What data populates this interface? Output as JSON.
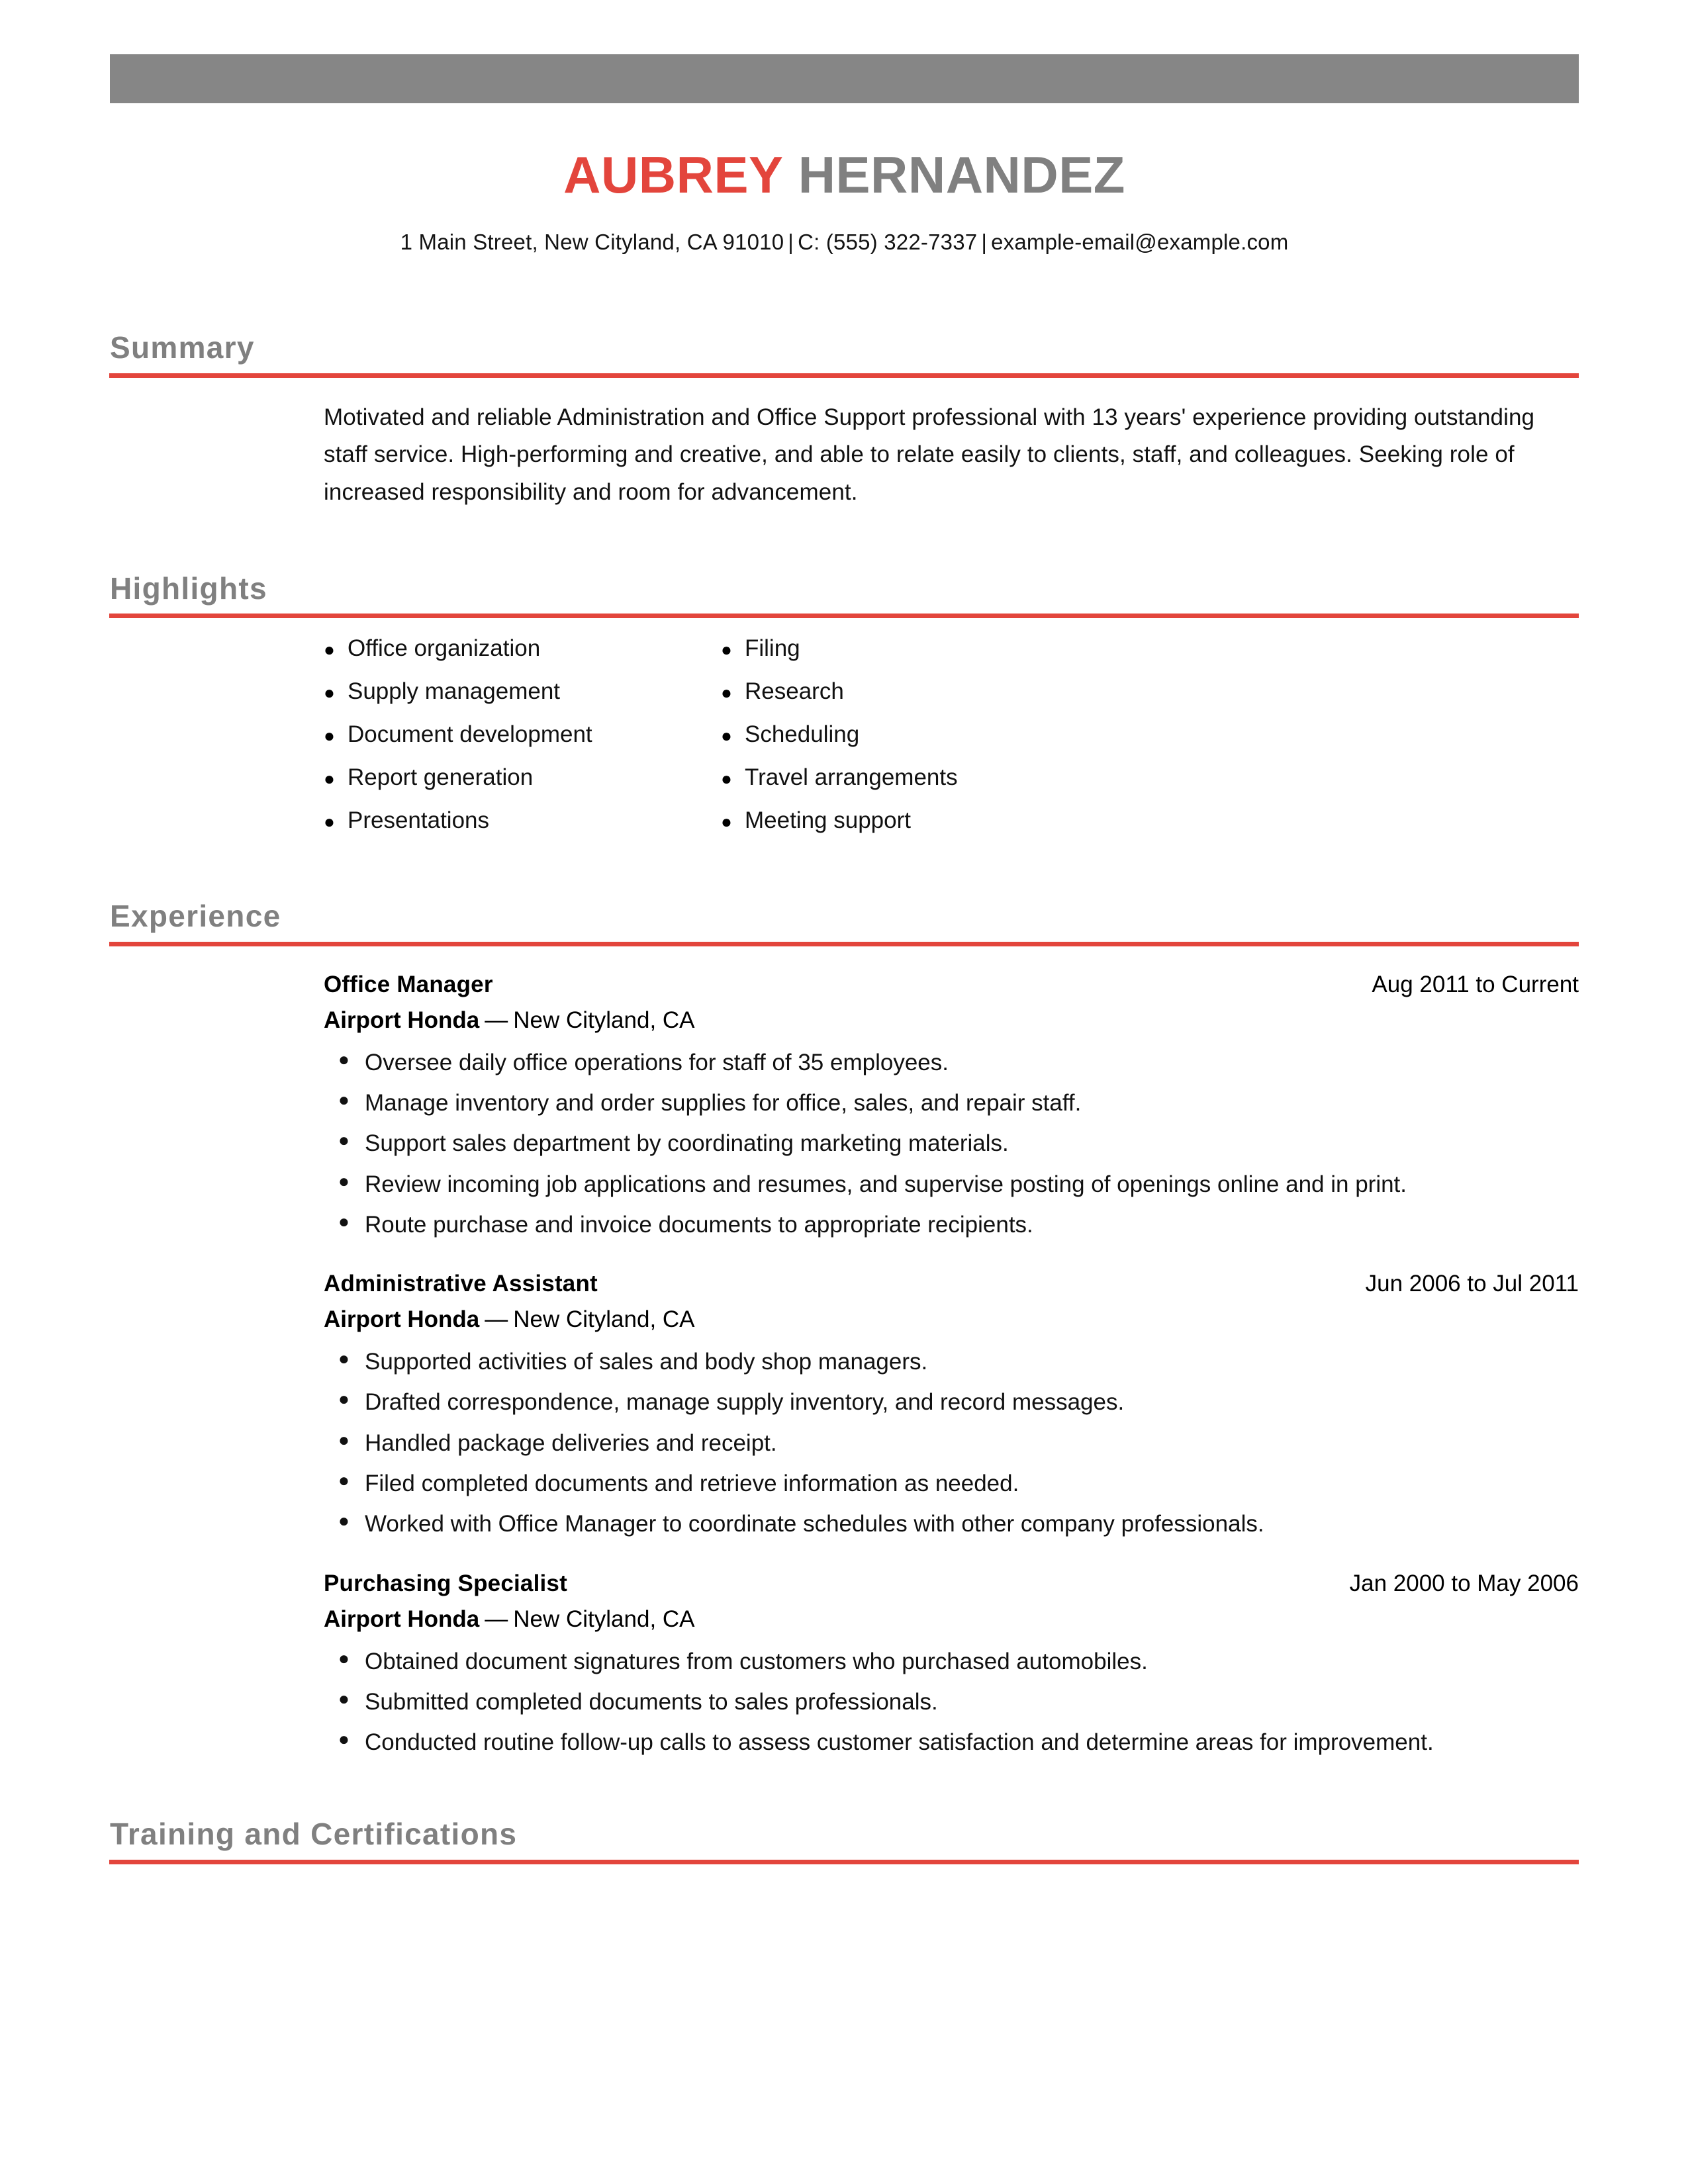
{
  "document": {
    "type": "resume",
    "accent_color": "#e3453c",
    "heading_color": "#808080",
    "banner_color": "#868686"
  },
  "header": {
    "first_name": "AUBREY",
    "last_name": "HERNANDEZ",
    "contact": {
      "address": "1 Main Street, New Cityland, CA 91010",
      "separator": "|",
      "phone": "C: (555) 322-7337",
      "email": "example-email@example.com"
    }
  },
  "sections": {
    "summary": {
      "title": "Summary",
      "text": "Motivated and reliable Administration and Office Support professional with 13 years' experience providing outstanding staff service. High-performing and creative, and able to relate easily to clients, staff, and colleagues. Seeking role of increased responsibility and room for advancement."
    },
    "highlights": {
      "title": "Highlights",
      "column_left": [
        "Office organization",
        "Supply management",
        "Document development",
        "Report generation",
        "Presentations"
      ],
      "column_right": [
        "Filing",
        "Research",
        "Scheduling",
        "Travel arrangements",
        "Meeting support"
      ]
    },
    "experience": {
      "title": "Experience",
      "jobs": [
        {
          "title": "Office Manager",
          "dates": "Aug 2011 to Current",
          "company": "Airport Honda",
          "dash": "—",
          "location": "New Cityland, CA",
          "bullets": [
            "Oversee daily office operations for staff of 35 employees.",
            "Manage inventory and order supplies for office, sales, and repair staff.",
            "Support sales department by coordinating marketing materials.",
            "Review incoming job applications and resumes, and supervise posting of openings online and in print.",
            "Route purchase and invoice documents to appropriate recipients."
          ]
        },
        {
          "title": "Administrative Assistant",
          "dates": "Jun 2006 to Jul 2011",
          "company": "Airport Honda",
          "dash": "—",
          "location": "New Cityland, CA",
          "bullets": [
            "Supported activities of sales and body shop managers.",
            "Drafted correspondence, manage supply inventory, and record messages.",
            "Handled package deliveries and receipt.",
            "Filed completed documents and retrieve information as needed.",
            "Worked with Office Manager to coordinate schedules with other company professionals."
          ]
        },
        {
          "title": "Purchasing Specialist",
          "dates": "Jan 2000 to May 2006",
          "company": "Airport Honda",
          "dash": "—",
          "location": "New Cityland, CA",
          "bullets": [
            "Obtained document signatures from customers who purchased automobiles.",
            "Submitted completed documents to sales professionals.",
            "Conducted routine follow-up calls to assess customer satisfaction and determine areas for improvement."
          ]
        }
      ]
    },
    "training": {
      "title": "Training and Certifications"
    }
  },
  "glyphs": {
    "bullet": "●"
  }
}
